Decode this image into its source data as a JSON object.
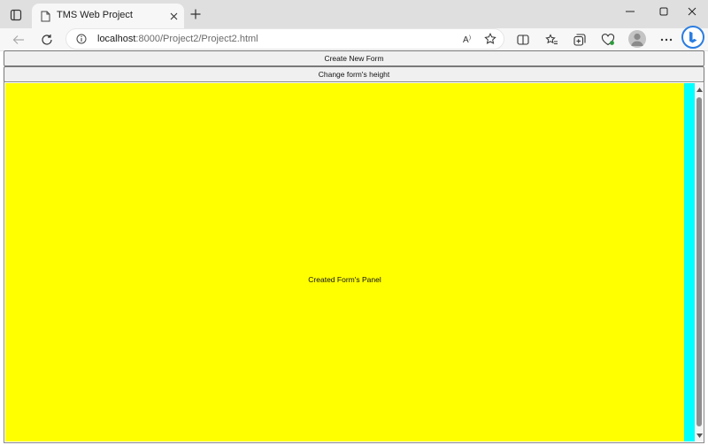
{
  "browser": {
    "tab": {
      "title": "TMS Web Project"
    },
    "address": {
      "host": "localhost",
      "path": ":8000/Project2/Project2.html"
    },
    "colors": {
      "tabstrip": "#dfdfdf",
      "toolbar": "#f7f7f7",
      "bing_accent": "#2a7de1"
    },
    "icons": [
      "tab-actions-icon",
      "page-icon",
      "close-icon",
      "plus-icon",
      "minimize-icon",
      "maximize-icon",
      "window-close-icon",
      "back-icon",
      "refresh-icon",
      "info-icon",
      "read-aloud-icon",
      "favorite-star-icon",
      "split-screen-icon",
      "favorites-icon",
      "collections-icon",
      "browser-essentials-icon",
      "profile-icon",
      "more-icon",
      "bing-copilot-icon"
    ]
  },
  "page": {
    "create_button": "Create New Form",
    "height_button": "Change form's height",
    "panel_label": "Created Form's Panel",
    "colors": {
      "panel": "#ffff00",
      "strip": "#00ffff"
    }
  }
}
